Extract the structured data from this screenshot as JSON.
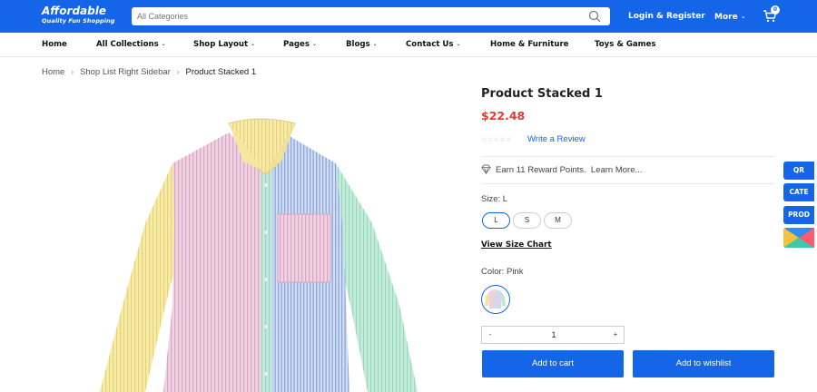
{
  "header": {
    "logo_title": "Affordable",
    "logo_tagline": "Quality Fun Shopping",
    "search_placeholder": "All Categories",
    "login_label": "Login & Register",
    "more_label": "More",
    "cart_count": "0"
  },
  "nav": {
    "items": [
      {
        "label": "Home",
        "dropdown": false
      },
      {
        "label": "All Collections",
        "dropdown": true
      },
      {
        "label": "Shop Layout",
        "dropdown": true
      },
      {
        "label": "Pages",
        "dropdown": true
      },
      {
        "label": "Blogs",
        "dropdown": true
      },
      {
        "label": "Contact Us",
        "dropdown": true
      },
      {
        "label": "Home & Furniture",
        "dropdown": false
      },
      {
        "label": "Toys & Games",
        "dropdown": false
      }
    ]
  },
  "breadcrumb": {
    "home": "Home",
    "parent": "Shop List Right Sidebar",
    "current": "Product Stacked 1"
  },
  "product": {
    "title": "Product Stacked 1",
    "price": "$22.48",
    "rating_stars": "☆☆☆☆☆",
    "review_link": "Write a Review",
    "reward_points": "Earn 11 Reward Points.",
    "learn_more": "Learn More...",
    "size_label": "Size: L",
    "sizes": [
      "L",
      "S",
      "M"
    ],
    "selected_size": "L",
    "size_chart_label": "View Size Chart",
    "color_label": "Color: Pink",
    "quantity": "1",
    "qty_minus": "-",
    "qty_plus": "+",
    "add_to_cart": "Add to cart",
    "add_to_wishlist": "Add to wishlist"
  },
  "floating": {
    "qr": "QR",
    "cate": "CATE",
    "prod": "PROD"
  },
  "colors": {
    "brand": "#1565e8",
    "price": "#e53935"
  }
}
